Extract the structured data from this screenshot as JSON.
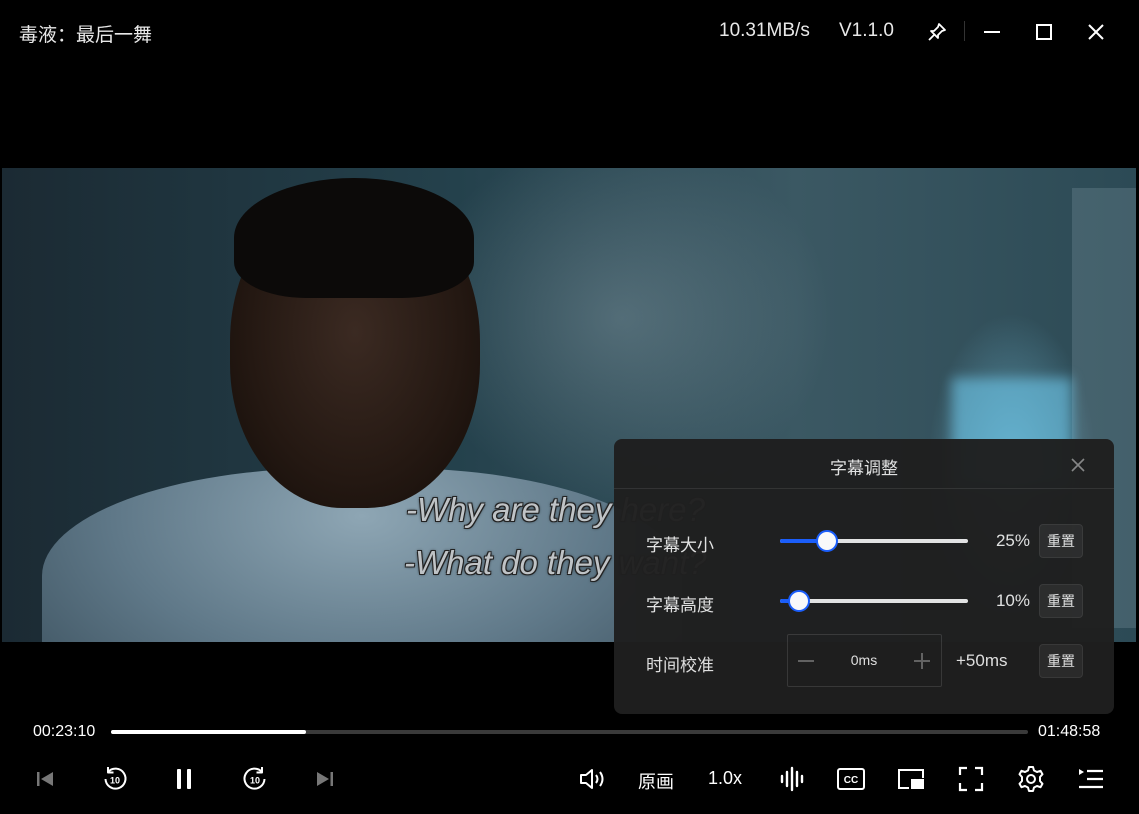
{
  "window": {
    "title": "毒液：最后一舞",
    "download_speed": "10.31MB/s",
    "version": "V1.1.0"
  },
  "subtitles": {
    "line1": "-Why are they here?",
    "line2": "-What do they want?"
  },
  "playback": {
    "current_time": "00:23:10",
    "total_time": "01:48:58",
    "progress_fraction": 0.2126
  },
  "controls": {
    "quality_label": "原画",
    "speed_label": "1.0x"
  },
  "subtitle_panel": {
    "title": "字幕调整",
    "size": {
      "label": "字幕大小",
      "value_text": "25%",
      "value": 25,
      "reset_label": "重置"
    },
    "height": {
      "label": "字幕高度",
      "value_text": "10%",
      "value": 10,
      "reset_label": "重置"
    },
    "timing": {
      "label": "时间校准",
      "value_text": "0ms",
      "step_text": "+50ms",
      "reset_label": "重置"
    }
  },
  "colors": {
    "accent": "#1a5fff",
    "panel_bg": "#1f1f1f"
  }
}
